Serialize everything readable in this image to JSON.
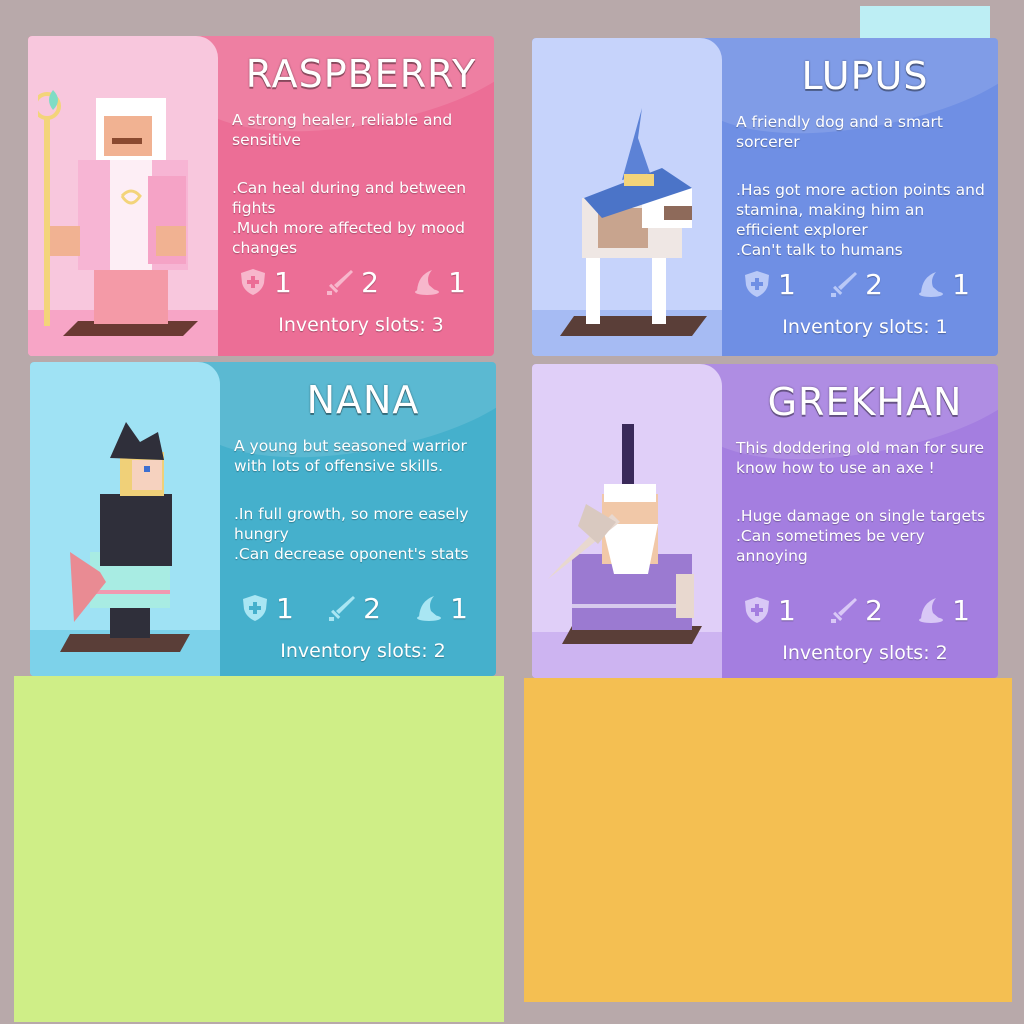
{
  "colors": {
    "background": "#b8a9aa",
    "raspberry": "#ec6e96",
    "lupus": "#6f8fe4",
    "nana": "#45b0cc",
    "grekhan": "#a47ee0",
    "green_block": "#cfee87",
    "orange_block": "#f4bf52"
  },
  "cards": [
    {
      "name": "RASPBERRY",
      "description": "A strong healer, reliable and sensitive",
      "traits": [
        ".Can heal during and between fights",
        ".Much more affected by mood changes"
      ],
      "defense": "1",
      "attack": "2",
      "magic": "1",
      "inventory": "Inventory slots: 3",
      "icons": [
        "shield-icon",
        "sword-icon",
        "wizard-hat-icon"
      ]
    },
    {
      "name": "LUPUS",
      "description": "A friendly dog and a smart sorcerer",
      "traits": [
        ".Has got more action points and stamina, making him an efficient explorer",
        ".Can't talk to humans"
      ],
      "defense": "1",
      "attack": "2",
      "magic": "1",
      "inventory": "Inventory slots: 1",
      "icons": [
        "shield-icon",
        "sword-icon",
        "wizard-hat-icon"
      ]
    },
    {
      "name": "NANA",
      "description": "A young but seasoned warrior with lots of offensive skills.",
      "traits": [
        ".In full growth, so more easely hungry",
        ".Can decrease oponent's stats"
      ],
      "defense": "1",
      "attack": "2",
      "magic": "1",
      "inventory": "Inventory slots: 2",
      "icons": [
        "shield-icon",
        "sword-icon",
        "wizard-hat-icon"
      ]
    },
    {
      "name": "GREKHAN",
      "description": "This doddering old man for sure know how to use an axe !",
      "traits": [
        ".Huge damage on single targets",
        ".Can sometimes be very annoying"
      ],
      "defense": "1",
      "attack": "2",
      "magic": "1",
      "inventory": "Inventory slots: 2",
      "icons": [
        "shield-icon",
        "sword-icon",
        "wizard-hat-icon"
      ]
    }
  ]
}
